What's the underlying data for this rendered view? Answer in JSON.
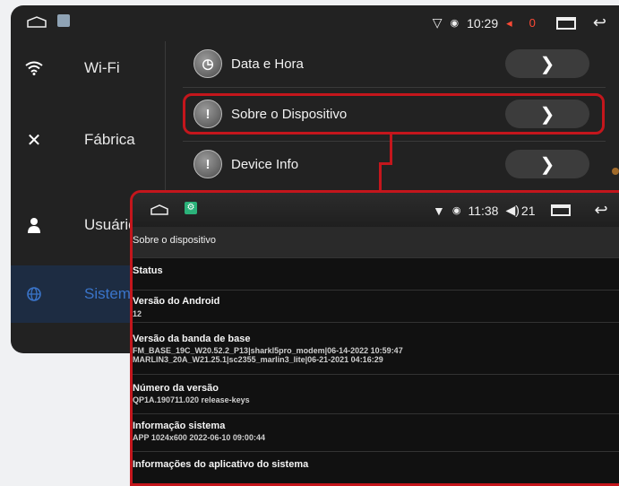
{
  "back_screen": {
    "statusbar": {
      "time": "10:29",
      "red_value": "0"
    },
    "sidebar": [
      {
        "label": "Wi-Fi",
        "icon": "wifi-icon"
      },
      {
        "label": "Fábrica",
        "icon": "tools-icon"
      },
      {
        "label": "Usuário",
        "icon": "user-icon"
      },
      {
        "label": "Sistema",
        "icon": "globe-icon"
      }
    ],
    "menu": [
      {
        "label": "Data e Hora",
        "icon": "clock-icon"
      },
      {
        "label": "Sobre o Dispositivo",
        "icon": "info-icon"
      },
      {
        "label": "Device Info",
        "icon": "info-icon"
      }
    ]
  },
  "front_screen": {
    "statusbar": {
      "time": "11:38",
      "volume": "21"
    },
    "title": "Sobre o dispositivo",
    "rows": [
      {
        "title": "Status",
        "value": ""
      },
      {
        "title": "Versão do Android",
        "value": "12"
      },
      {
        "title": "Versão da banda de base",
        "value": "FM_BASE_19C_W20.52.2_P13|sharkl5pro_modem|06-14-2022 10:59:47",
        "value2": "MARLIN3_20A_W21.25.1|sc2355_marlin3_lite|06-21-2021 04:16:29"
      },
      {
        "title": "Número da versão",
        "value": "QP1A.190711.020 release-keys"
      },
      {
        "title": "Informação sistema",
        "value": "APP 1024x600 2022-06-10 09:00:44"
      },
      {
        "title": "Informações do aplicativo do sistema",
        "value": ""
      }
    ]
  },
  "colors": {
    "highlight": "#c4161c",
    "active_sidebar_text": "#3a74c9"
  }
}
